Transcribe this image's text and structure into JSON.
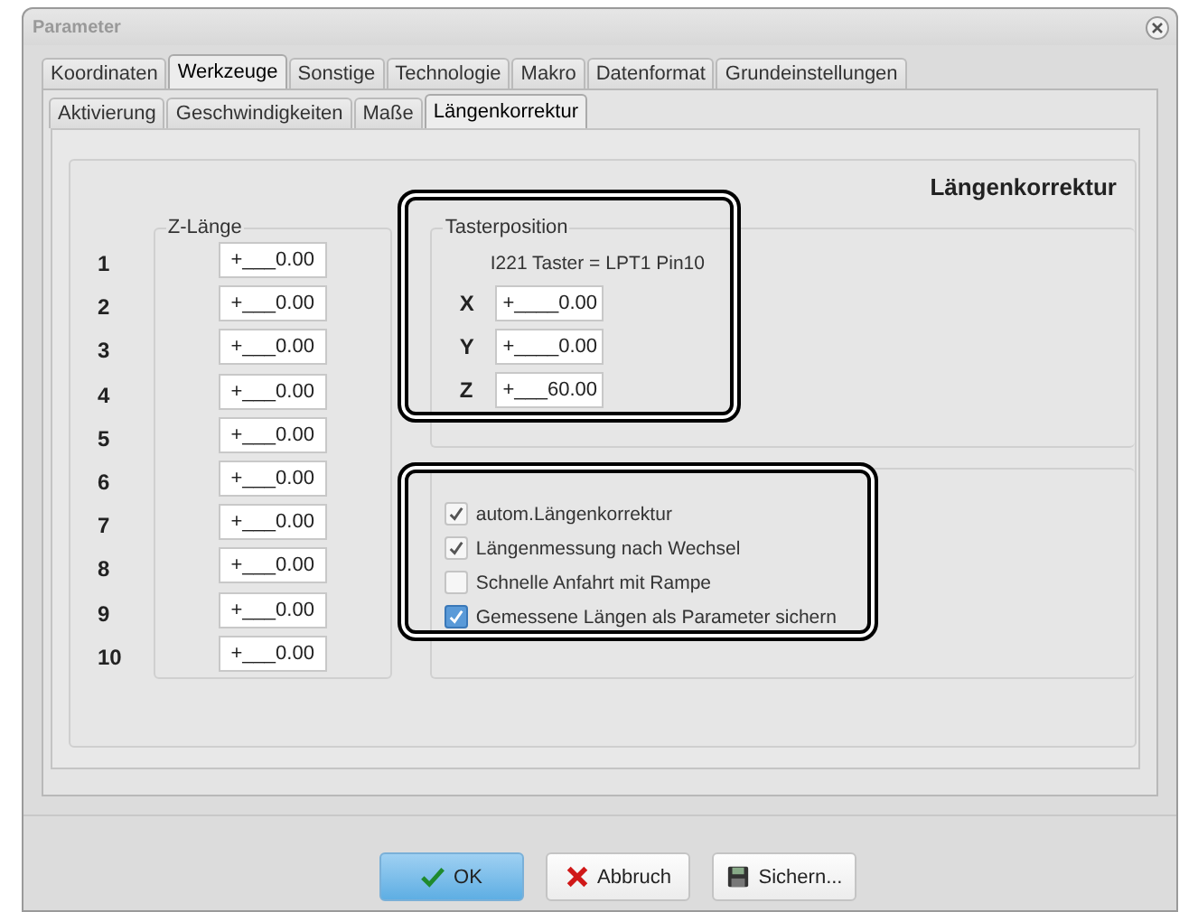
{
  "window": {
    "title": "Parameter"
  },
  "tabs": [
    {
      "label": "Koordinaten",
      "selected": false
    },
    {
      "label": "Werkzeuge",
      "selected": true
    },
    {
      "label": "Sonstige",
      "selected": false
    },
    {
      "label": "Technologie",
      "selected": false
    },
    {
      "label": "Makro",
      "selected": false
    },
    {
      "label": "Datenformat",
      "selected": false
    },
    {
      "label": "Grundeinstellungen",
      "selected": false
    }
  ],
  "subtabs": [
    {
      "label": "Aktivierung",
      "selected": false
    },
    {
      "label": "Geschwindigkeiten",
      "selected": false
    },
    {
      "label": "Maße",
      "selected": false
    },
    {
      "label": "Längenkorrektur",
      "selected": true
    }
  ],
  "panel_title": "Längenkorrektur",
  "z_length": {
    "legend": "Z-Länge",
    "rows": [
      {
        "number": "1",
        "value": "+___0.00"
      },
      {
        "number": "2",
        "value": "+___0.00"
      },
      {
        "number": "3",
        "value": "+___0.00"
      },
      {
        "number": "4",
        "value": "+___0.00"
      },
      {
        "number": "5",
        "value": "+___0.00"
      },
      {
        "number": "6",
        "value": "+___0.00"
      },
      {
        "number": "7",
        "value": "+___0.00"
      },
      {
        "number": "8",
        "value": "+___0.00"
      },
      {
        "number": "9",
        "value": "+___0.00"
      },
      {
        "number": "10",
        "value": "+___0.00"
      }
    ]
  },
  "probe": {
    "legend": "Tasterposition",
    "highlighted": true,
    "info": "I221 Taster = LPT1 Pin10",
    "axes": [
      {
        "axis": "X",
        "value": "+____0.00"
      },
      {
        "axis": "Y",
        "value": "+____0.00"
      },
      {
        "axis": "Z",
        "value": "+___60.00"
      }
    ]
  },
  "options": {
    "highlighted": true,
    "items": [
      {
        "label": "autom.Längenkorrektur",
        "checked": true,
        "kind": "plain"
      },
      {
        "label": "Längenmessung nach Wechsel",
        "checked": true,
        "kind": "plain"
      },
      {
        "label": "Schnelle Anfahrt mit Rampe",
        "checked": false,
        "kind": "plain"
      },
      {
        "label": "Gemessene Längen als Parameter sichern",
        "checked": true,
        "kind": "focus"
      }
    ]
  },
  "buttons": [
    {
      "label": "OK",
      "kind": "ok"
    },
    {
      "label": "Abbruch",
      "kind": "cancel"
    },
    {
      "label": "Sichern...",
      "kind": "save"
    }
  ]
}
